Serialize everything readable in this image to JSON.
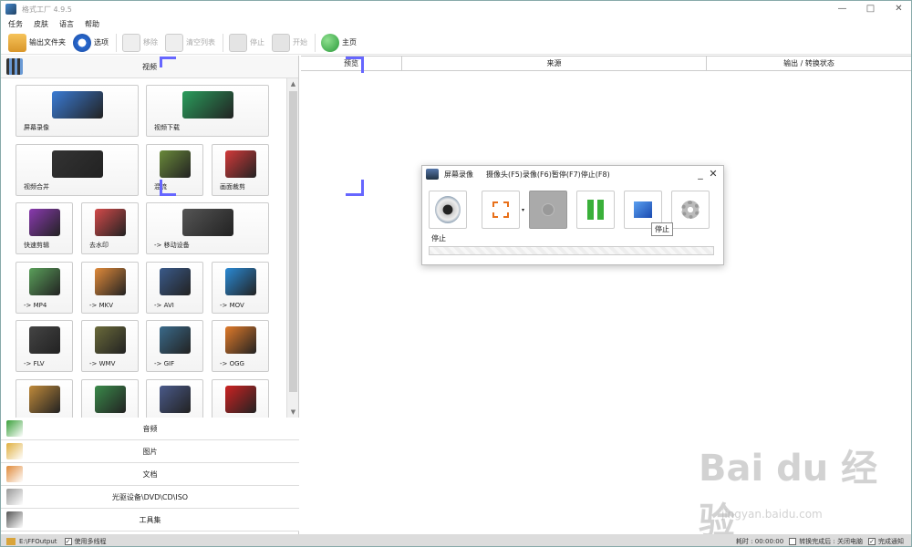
{
  "window": {
    "title": "格式工厂 4.9.5"
  },
  "menu": [
    "任务",
    "皮肤",
    "语言",
    "帮助"
  ],
  "toolbar": {
    "output_folder": "输出文件夹",
    "options": "选项",
    "remove": "移除",
    "clear_list": "清空列表",
    "stop": "停止",
    "start": "开始",
    "home": "主页"
  },
  "left": {
    "video_header": "视频",
    "tiles": [
      {
        "label": "屏幕录像",
        "icon": "screen-record-icon",
        "color": "#3a7bd5"
      },
      {
        "label": "视频下载",
        "icon": "video-download-icon",
        "color": "#2a9d5c"
      },
      {
        "label": "视频合并",
        "icon": "video-merge-icon",
        "color": "#333333"
      },
      {
        "label": "混流",
        "icon": "mux-icon",
        "color": "#6a8a3a"
      },
      {
        "label": "画面裁剪",
        "icon": "crop-icon",
        "color": "#d33a3a"
      },
      {
        "label": "快速剪辑",
        "icon": "quick-clip-icon",
        "color": "#8a3ab0"
      },
      {
        "label": "去水印",
        "icon": "remove-watermark-icon",
        "color": "#d34a4a"
      },
      {
        "label": "-> 移动设备",
        "icon": "mobile-device-icon",
        "color": "#555555"
      },
      {
        "label": "-> MP4",
        "icon": "mp4-icon",
        "color": "#5aa05a"
      },
      {
        "label": "-> MKV",
        "icon": "mkv-icon",
        "color": "#e08a3a"
      },
      {
        "label": "-> AVI",
        "icon": "avi-icon",
        "color": "#3a5a8a"
      },
      {
        "label": "-> MOV",
        "icon": "mov-icon",
        "color": "#2a8ad5"
      },
      {
        "label": "-> FLV",
        "icon": "flv-icon",
        "color": "#444444"
      },
      {
        "label": "-> WMV",
        "icon": "wmv-icon",
        "color": "#6a6a3a"
      },
      {
        "label": "-> GIF",
        "icon": "gif-icon",
        "color": "#3a6a8a"
      },
      {
        "label": "-> OGG",
        "icon": "ogg-icon",
        "color": "#e07a2a"
      },
      {
        "label": "",
        "icon": "webm-icon",
        "color": "#c08a3a"
      },
      {
        "label": "",
        "icon": "3gp-icon",
        "color": "#3a8a4a"
      },
      {
        "label": "",
        "icon": "mpeg-icon",
        "color": "#4a5a8a"
      },
      {
        "label": "",
        "icon": "swf-icon",
        "color": "#cc2222"
      }
    ],
    "categories": [
      {
        "label": "音频",
        "icon": "audio-icon"
      },
      {
        "label": "图片",
        "icon": "picture-icon"
      },
      {
        "label": "文档",
        "icon": "document-icon"
      },
      {
        "label": "光驱设备\\DVD\\CD\\ISO",
        "icon": "disc-icon"
      },
      {
        "label": "工具集",
        "icon": "toolbox-icon"
      }
    ]
  },
  "right": {
    "columns": [
      "预览",
      "来源",
      "输出 / 转换状态"
    ]
  },
  "dialog": {
    "name": "屏幕录像",
    "info": "摄像头(F5)录像(F6)暂停(F7)停止(F8)",
    "status": "停止",
    "tooltip": "停止"
  },
  "status": {
    "path": "E:\\FFOutput",
    "multithread": "使用多线程",
    "elapsed": "耗时 : 00:00:00",
    "after": "转换完成后 : 关闭电脑",
    "notify": "完成通知"
  },
  "watermark": {
    "main": "Bai du 经验",
    "sub": "jingyan.baidu.com"
  }
}
